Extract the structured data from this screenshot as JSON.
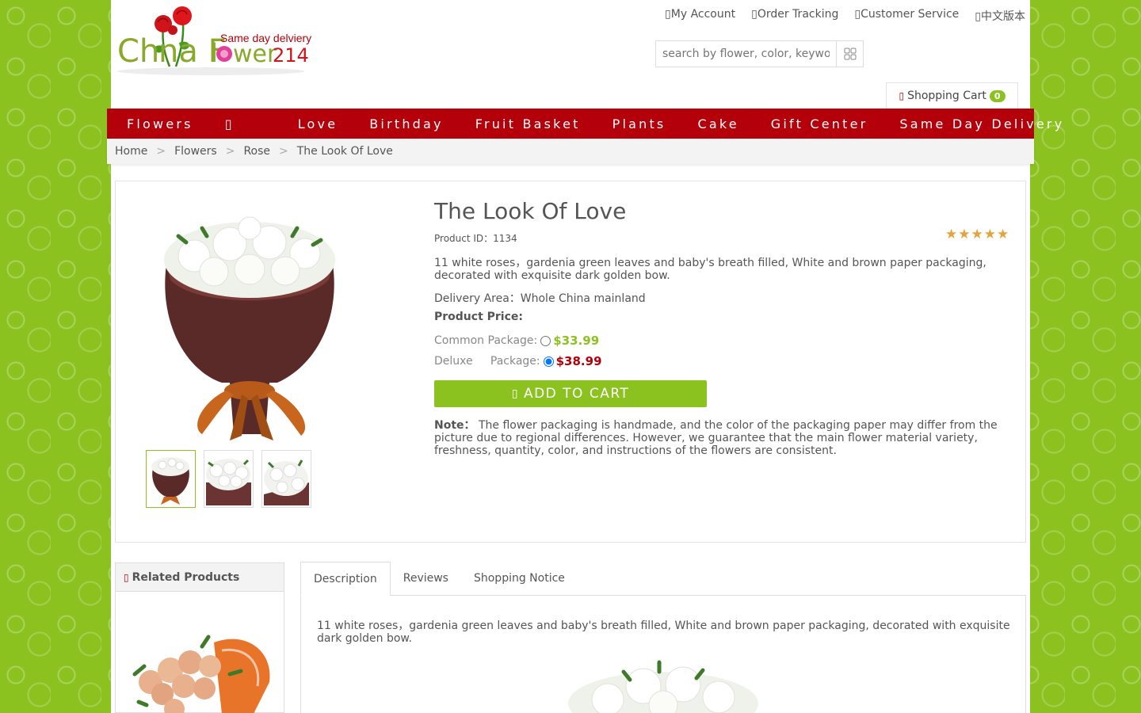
{
  "header": {
    "logo_text": "China Flower214",
    "logo_tagline": "Same day delviery",
    "links": [
      {
        "icon": "user-icon",
        "label": "My Account"
      },
      {
        "icon": "truck-icon",
        "label": "Order Tracking"
      },
      {
        "icon": "headset-icon",
        "label": "Customer Service"
      },
      {
        "icon": "globe-icon",
        "label": "中文版本"
      }
    ],
    "search": {
      "placeholder": "search by flower, color, keyword",
      "button_icon": "grid-search-icon"
    },
    "cart": {
      "icon": "cart-icon",
      "label": "Shopping Cart",
      "count": "0"
    }
  },
  "nav": [
    "Flowers",
    "Love",
    "Birthday",
    "Fruit Basket",
    "Plants",
    "Cake",
    "Gift Center",
    "Same Day Delivery"
  ],
  "breadcrumb": {
    "items": [
      "Home",
      "Flowers",
      "Rose",
      "The Look Of Love"
    ],
    "separator": ">"
  },
  "product": {
    "title": "The Look Of Love",
    "id_label": "Product ID：1134",
    "rating_stars": 5,
    "stars_text": "★★★★★",
    "description": "11 white roses，gardenia green leaves and baby's breath filled, White and brown paper packaging, decorated with exquisite dark golden bow.",
    "delivery_area": "Delivery Area：Whole China mainland",
    "price_label": "Product Price:",
    "options": [
      {
        "label": "Common Package:",
        "price": "$33.99",
        "color": "#8cc21f",
        "selected": false
      },
      {
        "label": "Deluxe     Package:",
        "price": "$38.99",
        "color": "#b3000b",
        "selected": true
      }
    ],
    "add_to_cart": "ADD TO CART",
    "note_label": "Note：",
    "note": "The flower packaging is handmade, and the color of the packaging paper may differ from the picture due to regional differences. However, we guarantee that the main flower material variety, freshness, quantity, color, and instructions of the flowers are consistent.",
    "thumbnails": 3
  },
  "related": {
    "title": "Related Products"
  },
  "tabs": {
    "items": [
      "Description",
      "Reviews",
      "Shopping Notice"
    ],
    "active": "Description",
    "description_text": "11 white roses，gardenia green leaves and baby's breath filled, White and brown paper packaging, decorated with exquisite dark golden bow."
  },
  "colors": {
    "brand_red": "#b3000b",
    "brand_green": "#8cc21f"
  }
}
